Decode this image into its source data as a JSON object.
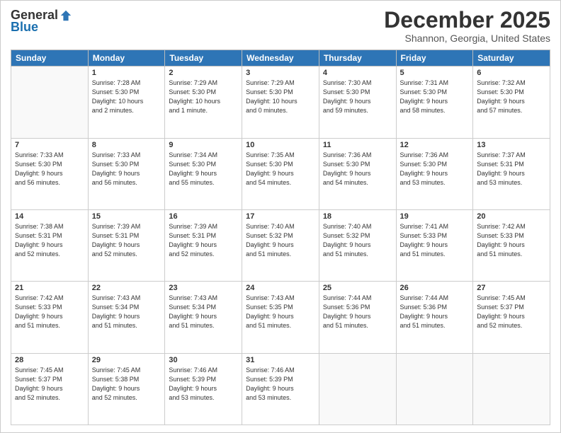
{
  "header": {
    "logo_general": "General",
    "logo_blue": "Blue",
    "month": "December 2025",
    "location": "Shannon, Georgia, United States"
  },
  "days_of_week": [
    "Sunday",
    "Monday",
    "Tuesday",
    "Wednesday",
    "Thursday",
    "Friday",
    "Saturday"
  ],
  "weeks": [
    [
      {
        "day": "",
        "info": ""
      },
      {
        "day": "1",
        "info": "Sunrise: 7:28 AM\nSunset: 5:30 PM\nDaylight: 10 hours\nand 2 minutes."
      },
      {
        "day": "2",
        "info": "Sunrise: 7:29 AM\nSunset: 5:30 PM\nDaylight: 10 hours\nand 1 minute."
      },
      {
        "day": "3",
        "info": "Sunrise: 7:29 AM\nSunset: 5:30 PM\nDaylight: 10 hours\nand 0 minutes."
      },
      {
        "day": "4",
        "info": "Sunrise: 7:30 AM\nSunset: 5:30 PM\nDaylight: 9 hours\nand 59 minutes."
      },
      {
        "day": "5",
        "info": "Sunrise: 7:31 AM\nSunset: 5:30 PM\nDaylight: 9 hours\nand 58 minutes."
      },
      {
        "day": "6",
        "info": "Sunrise: 7:32 AM\nSunset: 5:30 PM\nDaylight: 9 hours\nand 57 minutes."
      }
    ],
    [
      {
        "day": "7",
        "info": "Sunrise: 7:33 AM\nSunset: 5:30 PM\nDaylight: 9 hours\nand 56 minutes."
      },
      {
        "day": "8",
        "info": "Sunrise: 7:33 AM\nSunset: 5:30 PM\nDaylight: 9 hours\nand 56 minutes."
      },
      {
        "day": "9",
        "info": "Sunrise: 7:34 AM\nSunset: 5:30 PM\nDaylight: 9 hours\nand 55 minutes."
      },
      {
        "day": "10",
        "info": "Sunrise: 7:35 AM\nSunset: 5:30 PM\nDaylight: 9 hours\nand 54 minutes."
      },
      {
        "day": "11",
        "info": "Sunrise: 7:36 AM\nSunset: 5:30 PM\nDaylight: 9 hours\nand 54 minutes."
      },
      {
        "day": "12",
        "info": "Sunrise: 7:36 AM\nSunset: 5:30 PM\nDaylight: 9 hours\nand 53 minutes."
      },
      {
        "day": "13",
        "info": "Sunrise: 7:37 AM\nSunset: 5:31 PM\nDaylight: 9 hours\nand 53 minutes."
      }
    ],
    [
      {
        "day": "14",
        "info": "Sunrise: 7:38 AM\nSunset: 5:31 PM\nDaylight: 9 hours\nand 52 minutes."
      },
      {
        "day": "15",
        "info": "Sunrise: 7:39 AM\nSunset: 5:31 PM\nDaylight: 9 hours\nand 52 minutes."
      },
      {
        "day": "16",
        "info": "Sunrise: 7:39 AM\nSunset: 5:31 PM\nDaylight: 9 hours\nand 52 minutes."
      },
      {
        "day": "17",
        "info": "Sunrise: 7:40 AM\nSunset: 5:32 PM\nDaylight: 9 hours\nand 51 minutes."
      },
      {
        "day": "18",
        "info": "Sunrise: 7:40 AM\nSunset: 5:32 PM\nDaylight: 9 hours\nand 51 minutes."
      },
      {
        "day": "19",
        "info": "Sunrise: 7:41 AM\nSunset: 5:33 PM\nDaylight: 9 hours\nand 51 minutes."
      },
      {
        "day": "20",
        "info": "Sunrise: 7:42 AM\nSunset: 5:33 PM\nDaylight: 9 hours\nand 51 minutes."
      }
    ],
    [
      {
        "day": "21",
        "info": "Sunrise: 7:42 AM\nSunset: 5:33 PM\nDaylight: 9 hours\nand 51 minutes."
      },
      {
        "day": "22",
        "info": "Sunrise: 7:43 AM\nSunset: 5:34 PM\nDaylight: 9 hours\nand 51 minutes."
      },
      {
        "day": "23",
        "info": "Sunrise: 7:43 AM\nSunset: 5:34 PM\nDaylight: 9 hours\nand 51 minutes."
      },
      {
        "day": "24",
        "info": "Sunrise: 7:43 AM\nSunset: 5:35 PM\nDaylight: 9 hours\nand 51 minutes."
      },
      {
        "day": "25",
        "info": "Sunrise: 7:44 AM\nSunset: 5:36 PM\nDaylight: 9 hours\nand 51 minutes."
      },
      {
        "day": "26",
        "info": "Sunrise: 7:44 AM\nSunset: 5:36 PM\nDaylight: 9 hours\nand 51 minutes."
      },
      {
        "day": "27",
        "info": "Sunrise: 7:45 AM\nSunset: 5:37 PM\nDaylight: 9 hours\nand 52 minutes."
      }
    ],
    [
      {
        "day": "28",
        "info": "Sunrise: 7:45 AM\nSunset: 5:37 PM\nDaylight: 9 hours\nand 52 minutes."
      },
      {
        "day": "29",
        "info": "Sunrise: 7:45 AM\nSunset: 5:38 PM\nDaylight: 9 hours\nand 52 minutes."
      },
      {
        "day": "30",
        "info": "Sunrise: 7:46 AM\nSunset: 5:39 PM\nDaylight: 9 hours\nand 53 minutes."
      },
      {
        "day": "31",
        "info": "Sunrise: 7:46 AM\nSunset: 5:39 PM\nDaylight: 9 hours\nand 53 minutes."
      },
      {
        "day": "",
        "info": ""
      },
      {
        "day": "",
        "info": ""
      },
      {
        "day": "",
        "info": ""
      }
    ]
  ]
}
